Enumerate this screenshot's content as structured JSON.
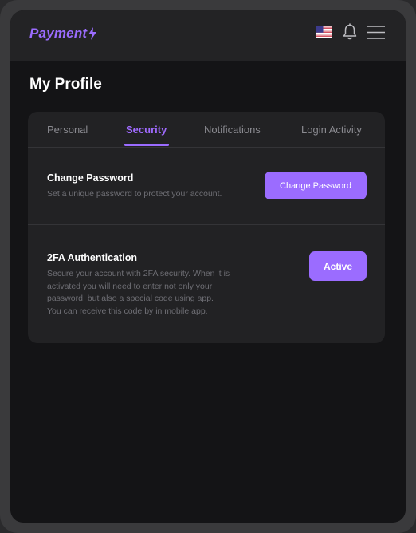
{
  "app": {
    "brand": "Payment"
  },
  "header": {
    "icons": [
      "us-flag-icon",
      "bell-icon",
      "hamburger-menu-icon"
    ]
  },
  "page": {
    "title": "My Profile"
  },
  "tabs": [
    {
      "label": "Personal",
      "active": false
    },
    {
      "label": "Security",
      "active": true
    },
    {
      "label": "Notifications",
      "active": false
    },
    {
      "label": "Login Activity",
      "active": false
    }
  ],
  "security": {
    "change_password": {
      "title": "Change Password",
      "description": "Set a unique password to protect your account.",
      "button_label": "Change Password"
    },
    "two_factor": {
      "title": "2FA Authentication",
      "description_lines": [
        "Secure your account with 2FA security. When it is",
        "activated you will need to enter not only your",
        "password, but also a special code using app.",
        "You can receive this code by in mobile app."
      ],
      "button_label": "Active"
    }
  },
  "colors": {
    "accent": "#9b6cff",
    "background": "#141416",
    "card": "#222224",
    "topbar": "#232325"
  }
}
